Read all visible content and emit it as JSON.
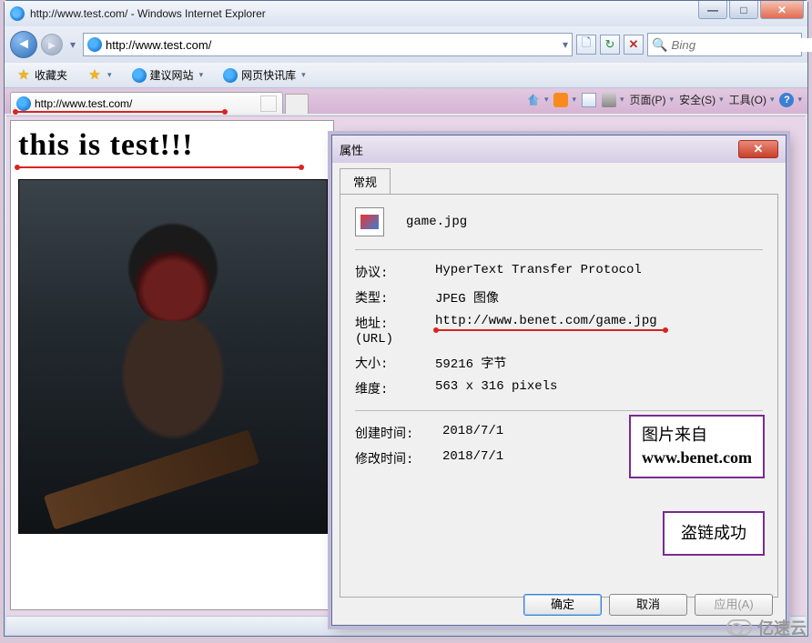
{
  "window": {
    "title": "http://www.test.com/ - Windows Internet Explorer"
  },
  "nav": {
    "url": "http://www.test.com/",
    "search_placeholder": "Bing"
  },
  "favbar": {
    "favorites": "收藏夹",
    "suggested": "建议网站",
    "webslice": "网页快讯库"
  },
  "tab": {
    "label": "http://www.test.com/"
  },
  "menus": {
    "page": "页面(P)",
    "safety": "安全(S)",
    "tools": "工具(O)"
  },
  "page": {
    "headline": "this is test!!!"
  },
  "props": {
    "title": "属性",
    "tab_general": "常规",
    "filename": "game.jpg",
    "labels": {
      "protocol": "协议:",
      "type": "类型:",
      "address": "地址:",
      "address_sub": "(URL)",
      "size": "大小:",
      "dimensions": "维度:",
      "created": "创建时间:",
      "modified": "修改时间:"
    },
    "values": {
      "protocol": "HyperText Transfer Protocol",
      "type": "JPEG 图像",
      "address": "http://www.benet.com/game.jpg",
      "size": "59216 字节",
      "dimensions": "563 x 316 pixels",
      "created": "2018/7/1",
      "modified": "2018/7/1"
    },
    "buttons": {
      "ok": "确定",
      "cancel": "取消",
      "apply": "应用(A)"
    }
  },
  "callout1_line1": "图片来自",
  "callout1_line2": "www.benet.com",
  "callout2": "盗链成功",
  "watermark": "亿速云"
}
